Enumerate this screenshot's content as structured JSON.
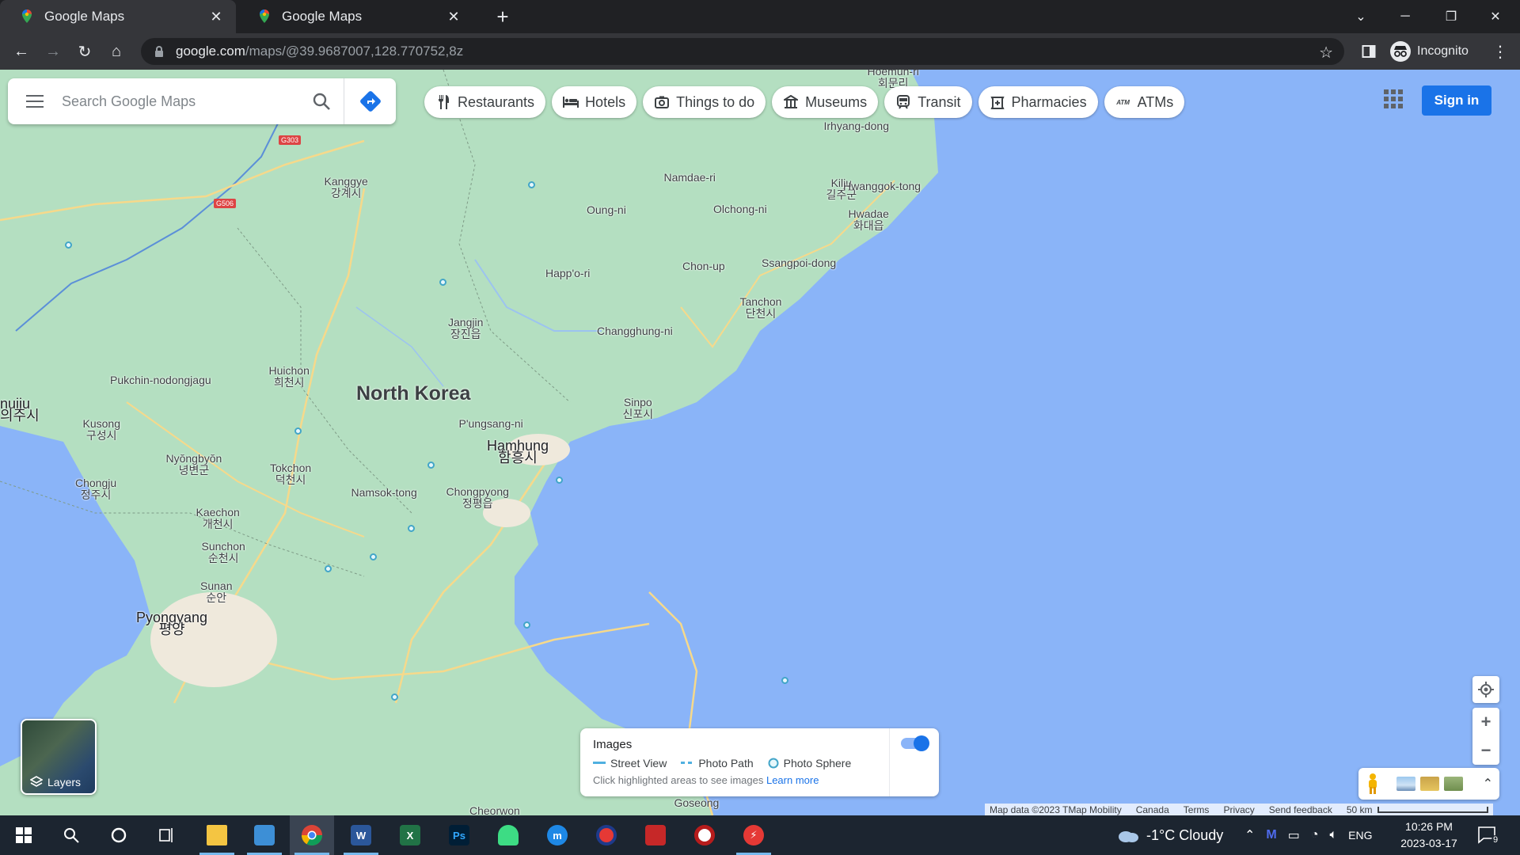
{
  "browser": {
    "tabs": [
      {
        "title": "Google Maps",
        "active": true
      },
      {
        "title": "Google Maps",
        "active": false
      }
    ],
    "url_host": "google.com",
    "url_path": "/maps/@39.9687007,128.770752,8z",
    "profile_label": "Incognito"
  },
  "maps": {
    "search_placeholder": "Search Google Maps",
    "chips": [
      {
        "label": "Restaurants",
        "icon": "fork-knife-icon"
      },
      {
        "label": "Hotels",
        "icon": "bed-icon"
      },
      {
        "label": "Things to do",
        "icon": "camera-icon"
      },
      {
        "label": "Museums",
        "icon": "museum-icon"
      },
      {
        "label": "Transit",
        "icon": "train-icon"
      },
      {
        "label": "Pharmacies",
        "icon": "pharmacy-icon"
      },
      {
        "label": "ATMs",
        "icon": "atm-icon"
      }
    ],
    "sign_in": "Sign in",
    "layers_label": "Layers",
    "images_panel": {
      "title": "Images",
      "street_view": "Street View",
      "photo_path": "Photo Path",
      "photo_sphere": "Photo Sphere",
      "hint": "Click highlighted areas to see images",
      "learn_more": "Learn more",
      "toggle_on": true
    },
    "attribution": {
      "map_data": "Map data ©2023 TMap Mobility",
      "country": "Canada",
      "terms": "Terms",
      "privacy": "Privacy",
      "feedback": "Send feedback",
      "scale": "50 km"
    },
    "places": {
      "country": "North Korea",
      "pyongyang_en": "Pyongyang",
      "pyongyang_kr": "평양",
      "hamhung_en": "Hamhung",
      "hamhung_kr": "함흥시",
      "hoemun": "Hoemun-ri",
      "hoemun_kr": "회문리",
      "irhyang": "Irhyang-dong",
      "kanggye_en": "Kanggye",
      "kanggye_kr": "강계시",
      "namdae": "Namdae-ri",
      "kilju_en": "Kilju",
      "kilju_kr": "길주군",
      "hwanggok": "Hwanggok-tong",
      "hwadae_en": "Hwadae",
      "hwadae_kr": "화대읍",
      "oung": "Oung-ni",
      "olchong": "Olchong-ni",
      "chonup": "Chon-up",
      "ssangpoi": "Ssangpoi-dong",
      "happori": "Happ'o-ri",
      "tanchon_en": "Tanchon",
      "tanchon_kr": "단천시",
      "jangjin_en": "Jangjin",
      "jangjin_kr": "장진읍",
      "changghung": "Changghung-ni",
      "huichon_en": "Huichon",
      "huichon_kr": "희천시",
      "pukchin": "Pukchin-nodongjagu",
      "sinuiju_en": "nuiju",
      "sinuiju_kr": "의주시",
      "sinpo_en": "Sinpo",
      "sinpo_kr": "신포시",
      "pungsang": "P'ungsang-ni",
      "kusong_en": "Kusong",
      "kusong_kr": "구성시",
      "nyongbyon_en": "Nyŏngbyŏn",
      "nyongbyon_kr": "녕변군",
      "tokchon_en": "Tokchon",
      "tokchon_kr": "덕천시",
      "namsok": "Namsok-tong",
      "chongpyong_en": "Chongpyong",
      "chongpyong_kr": "정평읍",
      "chongju_en": "Chongju",
      "chongju_kr": "정주시",
      "kaechon_en": "Kaechon",
      "kaechon_kr": "개천시",
      "sunchon_en": "Sunchon",
      "sunchon_kr": "순천시",
      "sunan_en": "Sunan",
      "sunan_kr": "순안",
      "cheorwon": "Cheorwon",
      "goseong": "Goseong",
      "g303": "G303",
      "g506": "G506"
    }
  },
  "taskbar": {
    "weather": "-1°C Cloudy",
    "lang": "ENG",
    "time": "10:26 PM",
    "date": "2023-03-17",
    "notifications": "9",
    "apps": [
      "start",
      "search",
      "cortana",
      "task-view",
      "file-explorer",
      "control-panel",
      "chrome",
      "word",
      "excel",
      "photoshop",
      "android",
      "mu",
      "app-circle",
      "app-red",
      "app-disc",
      "app-flash"
    ]
  },
  "colors": {
    "land": "#b7e0c5",
    "water": "#8ab4f8",
    "accent": "#1a73e8",
    "chrome_dark": "#202124",
    "taskbar": "#1c2530"
  }
}
